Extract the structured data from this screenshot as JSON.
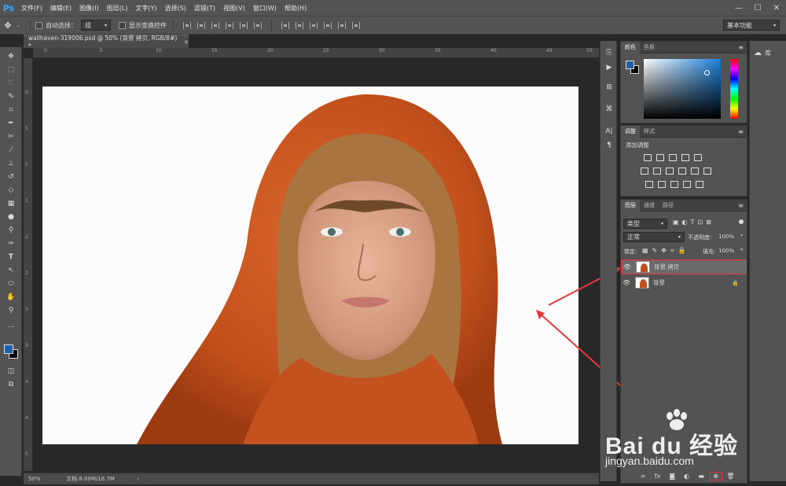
{
  "app": {
    "logo": "Ps",
    "menus": [
      "文件(F)",
      "编辑(E)",
      "图像(I)",
      "图层(L)",
      "文字(Y)",
      "选择(S)",
      "滤镜(T)",
      "视图(V)",
      "窗口(W)",
      "帮助(H)"
    ]
  },
  "options": {
    "auto_select_label": "自动选择：",
    "auto_select_value": "组",
    "show_transform_label": "显示变换控件",
    "workspace": "基本功能"
  },
  "document": {
    "tab_title": "wallhaven-319006.psd @ 50% (背景 拷贝, RGB/8#) *",
    "zoom": "50%",
    "doc_size": "文档:8.00M/18.7M"
  },
  "rulers": {
    "top": [
      "0",
      "5",
      "10",
      "15",
      "20",
      "25",
      "30",
      "35",
      "40",
      "45",
      "50"
    ],
    "left": [
      "0",
      "5",
      "1",
      "1",
      "2",
      "2",
      "3",
      "3",
      "4",
      "4",
      "5"
    ]
  },
  "panels": {
    "color_tabs": [
      "颜色",
      "色板"
    ],
    "adjust_tabs": [
      "调整",
      "样式"
    ],
    "adjust_title": "添加调整",
    "layers_tabs": [
      "图层",
      "通道",
      "路径"
    ],
    "filter_kind": "类型",
    "blend_mode": "正常",
    "opacity_label": "不透明度:",
    "opacity_value": "100%",
    "lock_label": "锁定:",
    "fill_label": "填充:",
    "fill_value": "100%",
    "library_label": "库"
  },
  "layers": [
    {
      "name": "背景 拷贝",
      "selected": true
    },
    {
      "name": "背景",
      "selected": false
    }
  ],
  "watermark": {
    "brand": "Bai du 经验",
    "url": "jingyan.baidu.com"
  },
  "colors": {
    "foreground": "#1d5fa8",
    "background": "#000000",
    "annotation": "#e8373a"
  }
}
